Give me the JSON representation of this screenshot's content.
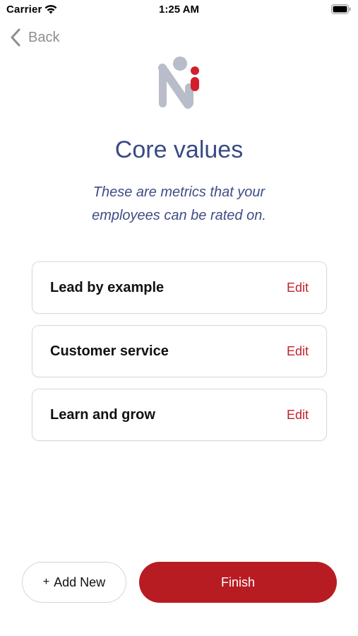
{
  "status_bar": {
    "carrier": "Carrier",
    "time": "1:25 AM",
    "wifi_icon": "wifi-icon",
    "battery_icon": "battery-icon"
  },
  "nav": {
    "back_label": "Back",
    "back_icon": "chevron-left-icon"
  },
  "logo": {
    "icon": "company-logo",
    "colors": {
      "letter": "#b9bcc9",
      "accent": "#d21f2d"
    }
  },
  "header": {
    "title": "Core values",
    "subtitle": "These are metrics that your employees can be rated on."
  },
  "values": [
    {
      "name": "Lead by example",
      "action": "Edit"
    },
    {
      "name": "Customer service",
      "action": "Edit"
    },
    {
      "name": "Learn and grow",
      "action": "Edit"
    }
  ],
  "actions": {
    "add_new_symbol": "+",
    "add_new_label": "Add New",
    "finish_label": "Finish"
  },
  "colors": {
    "title": "#3b4a85",
    "accent": "#b81c23",
    "edit": "#c2222b",
    "back": "#8e8e93"
  }
}
